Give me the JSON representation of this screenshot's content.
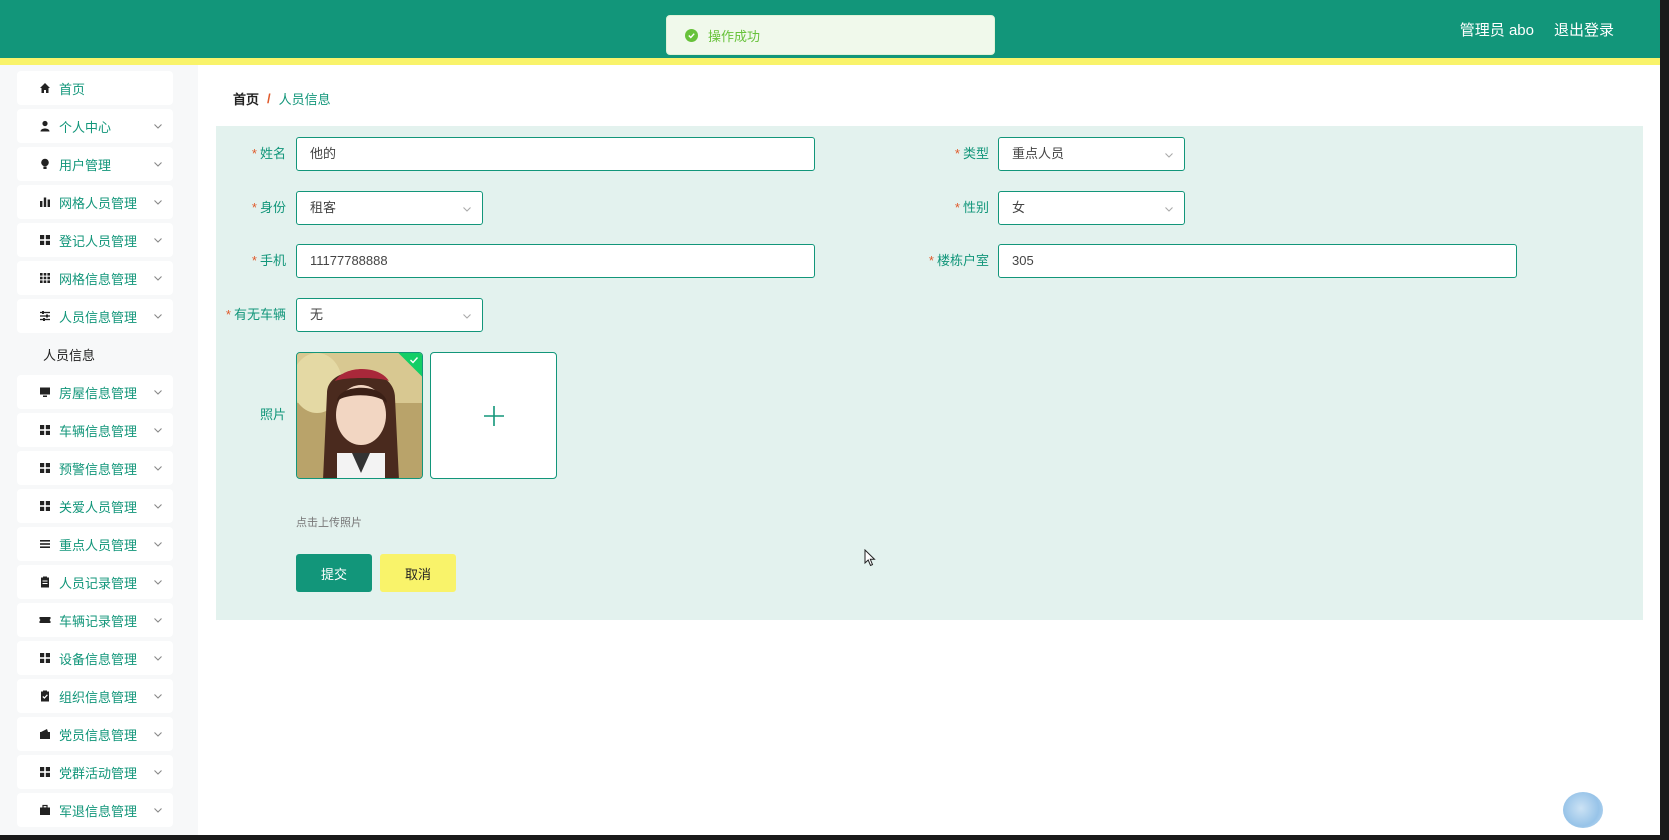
{
  "header": {
    "user_label": "管理员 abo",
    "logout_label": "退出登录"
  },
  "toast": {
    "message": "操作成功"
  },
  "sidebar": {
    "items": [
      {
        "label": "首页",
        "icon": "home-icon",
        "expandable": false
      },
      {
        "label": "个人中心",
        "icon": "user-icon",
        "expandable": true
      },
      {
        "label": "用户管理",
        "icon": "bulb-icon",
        "expandable": true
      },
      {
        "label": "网格人员管理",
        "icon": "bar-chart-icon",
        "expandable": true
      },
      {
        "label": "登记人员管理",
        "icon": "grid-icon",
        "expandable": true
      },
      {
        "label": "网格信息管理",
        "icon": "grid-dots-icon",
        "expandable": true
      },
      {
        "label": "人员信息管理",
        "icon": "sliders-icon",
        "expandable": true
      },
      {
        "label": "人员信息",
        "icon": "",
        "expandable": false,
        "submenu": true
      },
      {
        "label": "房屋信息管理",
        "icon": "monitor-icon",
        "expandable": true
      },
      {
        "label": "车辆信息管理",
        "icon": "grid-icon",
        "expandable": true
      },
      {
        "label": "预警信息管理",
        "icon": "grid-icon",
        "expandable": true
      },
      {
        "label": "关爱人员管理",
        "icon": "grid-icon",
        "expandable": true
      },
      {
        "label": "重点人员管理",
        "icon": "list-icon",
        "expandable": true
      },
      {
        "label": "人员记录管理",
        "icon": "clipboard-icon",
        "expandable": true
      },
      {
        "label": "车辆记录管理",
        "icon": "ticket-icon",
        "expandable": true
      },
      {
        "label": "设备信息管理",
        "icon": "grid-icon",
        "expandable": true
      },
      {
        "label": "组织信息管理",
        "icon": "clipboard-check-icon",
        "expandable": true
      },
      {
        "label": "党员信息管理",
        "icon": "wallet-icon",
        "expandable": true
      },
      {
        "label": "党群活动管理",
        "icon": "grid-icon",
        "expandable": true
      },
      {
        "label": "军退信息管理",
        "icon": "briefcase-icon",
        "expandable": true
      }
    ]
  },
  "breadcrumb": {
    "home": "首页",
    "separator": "/",
    "current": "人员信息"
  },
  "form": {
    "name_label": "姓名",
    "name_value": "他的",
    "type_label": "类型",
    "type_value": "重点人员",
    "identity_label": "身份",
    "identity_value": "租客",
    "gender_label": "性别",
    "gender_value": "女",
    "phone_label": "手机",
    "phone_value": "11177788888",
    "room_label": "楼栋户室",
    "room_value": "305",
    "vehicle_label": "有无车辆",
    "vehicle_value": "无",
    "photo_label": "照片",
    "upload_hint": "点击上传照片",
    "required_mark": "*",
    "submit_label": "提交",
    "cancel_label": "取消"
  },
  "colors": {
    "primary": "#12967a",
    "accent_yellow": "#f9f36a",
    "panel_bg": "#e3f2ee",
    "required": "#e05a2b",
    "success": "#67c23a"
  }
}
